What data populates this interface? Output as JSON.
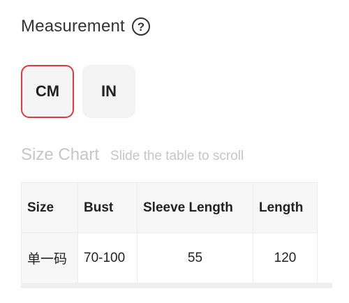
{
  "measurement": {
    "title": "Measurement",
    "help_symbol": "?"
  },
  "units": {
    "cm_label": "CM",
    "in_label": "IN",
    "selected": "CM",
    "selected_color": "#e0393e"
  },
  "size_chart": {
    "title": "Size Chart",
    "hint": "Slide the table to scroll"
  },
  "table": {
    "headers": [
      "Size",
      "Bust",
      "Sleeve Length",
      "Length"
    ],
    "rows": [
      [
        "单一码",
        "70-100",
        "55",
        "120"
      ]
    ]
  }
}
